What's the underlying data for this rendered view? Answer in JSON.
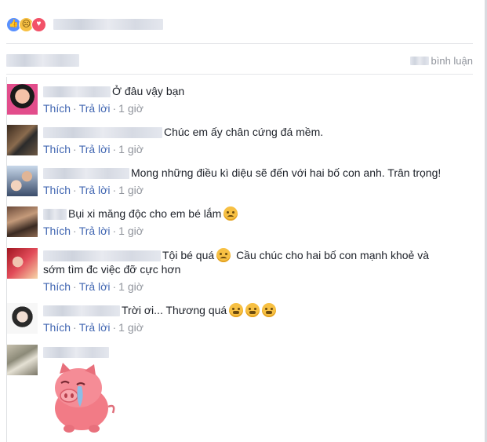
{
  "reactions": {
    "icons": [
      "like-icon",
      "sad-icon",
      "love-icon"
    ],
    "colors": {
      "like": "#5890ff",
      "sad": "#f7c043",
      "love": "#f25268"
    }
  },
  "comments_header": {
    "count_label": "bình luận"
  },
  "colors": {
    "link": "#4267b2",
    "meta": "#90949c",
    "text": "#1d2129"
  },
  "actions": {
    "like": "Thích",
    "reply": "Trả lời",
    "separator": "·"
  },
  "comments": [
    {
      "text": "Ở đâu vậy bạn",
      "time": "1 giờ"
    },
    {
      "text": "Chúc em ấy chân cứng đá mềm.",
      "time": "1 giờ"
    },
    {
      "text": "Mong những điều kì diệu sẽ đến với hai bố con anh. Trân trọng!",
      "time": "1 giờ"
    },
    {
      "text": "Bụi xi măng độc cho em bé lắm",
      "time": "1 giờ",
      "emoji": "sad-face-icon"
    },
    {
      "text_a": "Tội bé quá",
      "text_b": "Cầu chúc cho hai bố con mạnh khoẻ và",
      "text_line2": "sớm tìm đc việc đỡ cực hơn",
      "time": "1 giờ"
    },
    {
      "text": "Trời ơi... Thương quá",
      "time": "1 giờ",
      "emoji": "crying-face-icon"
    },
    {
      "sticker": "crying-pig-sticker"
    }
  ]
}
